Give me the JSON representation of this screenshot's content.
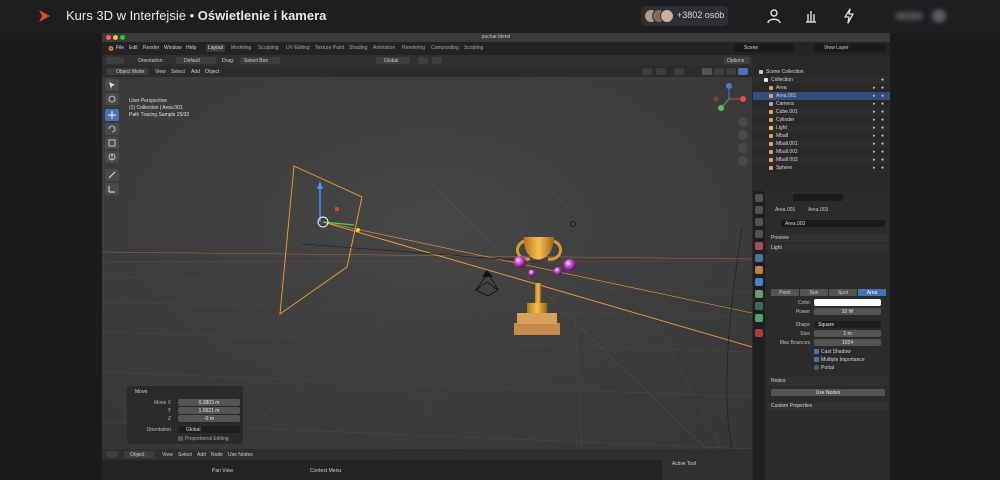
{
  "topbar": {
    "course_title": "Kurs 3D w Interfejsie",
    "separator": "•",
    "lesson_title": "Oświetlenie i kamera",
    "viewers_count": "+3802 osób"
  },
  "window": {
    "file_title": "puchar.blend"
  },
  "menu": [
    "File",
    "Edit",
    "Render",
    "Window",
    "Help"
  ],
  "workspaces": [
    "Layout",
    "Modeling",
    "Sculpting",
    "UV Editing",
    "Texture Paint",
    "Shading",
    "Animation",
    "Rendering",
    "Compositing",
    "Scripting"
  ],
  "scene": {
    "scene_name": "Scene",
    "view_layer": "View Layer"
  },
  "header": {
    "orientation_label": "Orientation:",
    "orientation_value": "Default",
    "drag_label": "Drag:",
    "drag_value": "Select Box",
    "transform_value": "Global",
    "options_label": "Options",
    "mode": "Object Mode",
    "view": "View",
    "select": "Select",
    "add": "Add",
    "object": "Object"
  },
  "viewport": {
    "view_name": "User Perspective",
    "collection_line": "(1) Collection | Area.001",
    "sample_line": "Path Tracing Sample 25/32"
  },
  "move_panel": {
    "title": "Move",
    "fields": [
      {
        "label": "Move X",
        "value": "0.2803 m"
      },
      {
        "label": "Y",
        "value": "1.0621 m"
      },
      {
        "label": "Z",
        "value": "-0 m"
      }
    ],
    "orientation_label": "Orientation",
    "orientation_value": "Global",
    "proportional_label": "Proportional Editing"
  },
  "timeline": {
    "menu": [
      "Object",
      "View",
      "Select",
      "Add",
      "Node"
    ],
    "use_nodes": "Use Nodes"
  },
  "status": {
    "left": "Pan View",
    "middle": "Context Menu",
    "version": "2.93.0"
  },
  "active_tool": {
    "label": "Active Tool"
  },
  "outliner": {
    "root": "Scene Collection",
    "collection": "Collection",
    "items": [
      {
        "name": "Area",
        "color": "#e8a050",
        "selected": false
      },
      {
        "name": "Area.001",
        "color": "#e8a050",
        "selected": true
      },
      {
        "name": "Camera",
        "color": "#8fb0d8",
        "selected": false
      },
      {
        "name": "Cube.001",
        "color": "#e8a050",
        "selected": false
      },
      {
        "name": "Cylinder",
        "color": "#e8a050",
        "selected": false
      },
      {
        "name": "Light",
        "color": "#e8c060",
        "selected": false
      },
      {
        "name": "Mball",
        "color": "#e8a050",
        "selected": false
      },
      {
        "name": "Mball.001",
        "color": "#e8a050",
        "selected": false
      },
      {
        "name": "Mball.002",
        "color": "#e8a050",
        "selected": false
      },
      {
        "name": "Mball.003",
        "color": "#e8a050",
        "selected": false
      },
      {
        "name": "Sphere",
        "color": "#e8a050",
        "selected": false
      }
    ]
  },
  "properties": {
    "breadcrumb_object": "Area.001",
    "breadcrumb_data": "Area.003",
    "datablock_name": "Area.003",
    "preview_label": "Preview",
    "light_label": "Light",
    "light_types": [
      "Point",
      "Sun",
      "Spot",
      "Area"
    ],
    "active_light_type": "Area",
    "color_label": "Color",
    "power_label": "Power",
    "power_value": "10 W",
    "shape_label": "Shape",
    "shape_value": "Square",
    "size_label": "Size",
    "size_value": "1 m",
    "max_bounces_label": "Max Bounces",
    "max_bounces_value": "1024",
    "cast_shadow": "Cast Shadow",
    "multiple_importance": "Multiple Importance",
    "portal": "Portal",
    "nodes_label": "Nodes",
    "use_nodes": "Use Nodes",
    "custom_props": "Custom Properties"
  },
  "colors": {
    "accent": "#4772b3",
    "selection_orange": "#f5a030",
    "brand_red": "#e8453c"
  },
  "icons": [
    "play-logo-icon",
    "user-icon",
    "hand-raise-icon",
    "lightning-icon",
    "camera-icon",
    "trophy-icon"
  ]
}
